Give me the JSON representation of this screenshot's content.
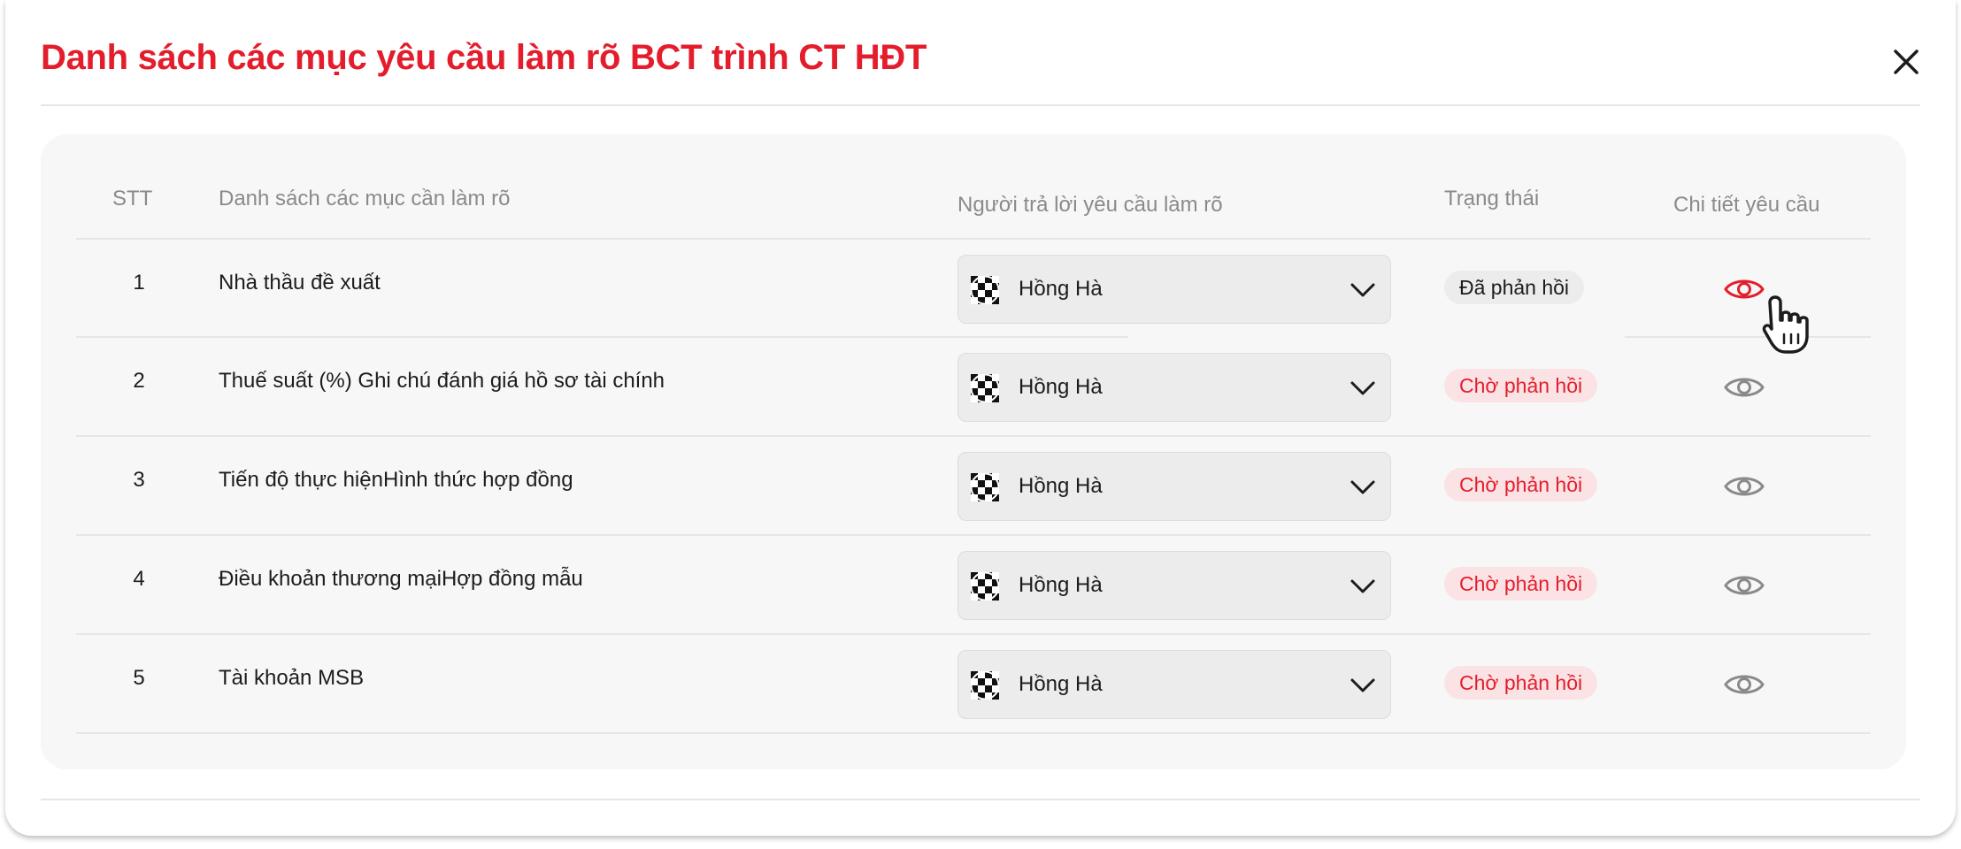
{
  "dialog": {
    "title": "Danh sách các mục yêu cầu làm rõ BCT trình CT HĐT",
    "close_icon": "close-icon"
  },
  "table": {
    "headers": {
      "stt": "STT",
      "items": "Danh sách các mục cần làm rõ",
      "responder": "Người trả lời yêu cầu làm rõ",
      "status": "Trạng thái",
      "detail": "Chi tiết yêu cầu"
    },
    "rows": [
      {
        "stt": "1",
        "item": "Nhà thầu đề xuất",
        "responder": "Hồng Hà",
        "status": "Đã phản hồi",
        "status_type": "done"
      },
      {
        "stt": "2",
        "item": "Thuế suất (%) Ghi chú đánh giá hồ sơ tài chính",
        "responder": "Hồng Hà",
        "status": "Chờ phản hồi",
        "status_type": "waiting"
      },
      {
        "stt": "3",
        "item": "Tiến độ thực hiệnHình thức hợp đồng",
        "responder": "Hồng Hà",
        "status": "Chờ phản hồi",
        "status_type": "waiting"
      },
      {
        "stt": "4",
        "item": "Điều khoản thương mạiHợp đồng mẫu",
        "responder": "Hồng Hà",
        "status": "Chờ phản hồi",
        "status_type": "waiting"
      },
      {
        "stt": "5",
        "item": "Tài khoản MSB",
        "responder": "Hồng Hà",
        "status": "Chờ phản hồi",
        "status_type": "waiting"
      }
    ],
    "icons": {
      "avatar": "checkered-avatar-icon",
      "dropdown": "chevron-down-icon",
      "detail": "eye-icon",
      "pointer": "hand-pointer-icon"
    },
    "hovered_detail_row": 1
  },
  "colors": {
    "accent": "#e31d2c",
    "badge_waiting_bg": "#fbe3e5",
    "badge_done_bg": "#ececec",
    "eye_default": "#8a8a8a",
    "card_bg": "#f7f7f7"
  }
}
